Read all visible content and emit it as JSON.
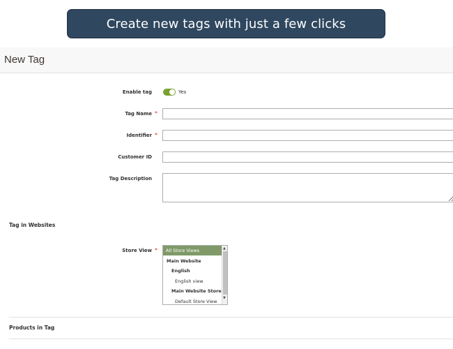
{
  "banner": {
    "text": "Create new tags with just a few clicks"
  },
  "header": {
    "title": "New Tag"
  },
  "form": {
    "enable_tag": {
      "label": "Enable tag",
      "value": "Yes",
      "enabled": true,
      "accent": "#79a22e"
    },
    "tag_name": {
      "label": "Tag Name",
      "value": "",
      "required": "*"
    },
    "identifier": {
      "label": "Identifier",
      "value": "",
      "required": "*"
    },
    "customer_id": {
      "label": "Customer ID",
      "value": ""
    },
    "tag_description": {
      "label": "Tag Description",
      "value": ""
    }
  },
  "websites_section": {
    "title": "Tag in Websites",
    "store_view": {
      "label": "Store View",
      "required": "*",
      "options": [
        {
          "label": "All Store Views",
          "selected": true
        },
        {
          "label": "Main Website"
        },
        {
          "label": "English"
        },
        {
          "label": "English view"
        },
        {
          "label": "Main Website Store"
        },
        {
          "label": "Default Store View"
        }
      ]
    }
  },
  "products_section": {
    "title": "Products in Tag"
  },
  "colors": {
    "banner_bg": "#2f475f",
    "required": "#e22626",
    "selected_option": "#7f9a68"
  }
}
